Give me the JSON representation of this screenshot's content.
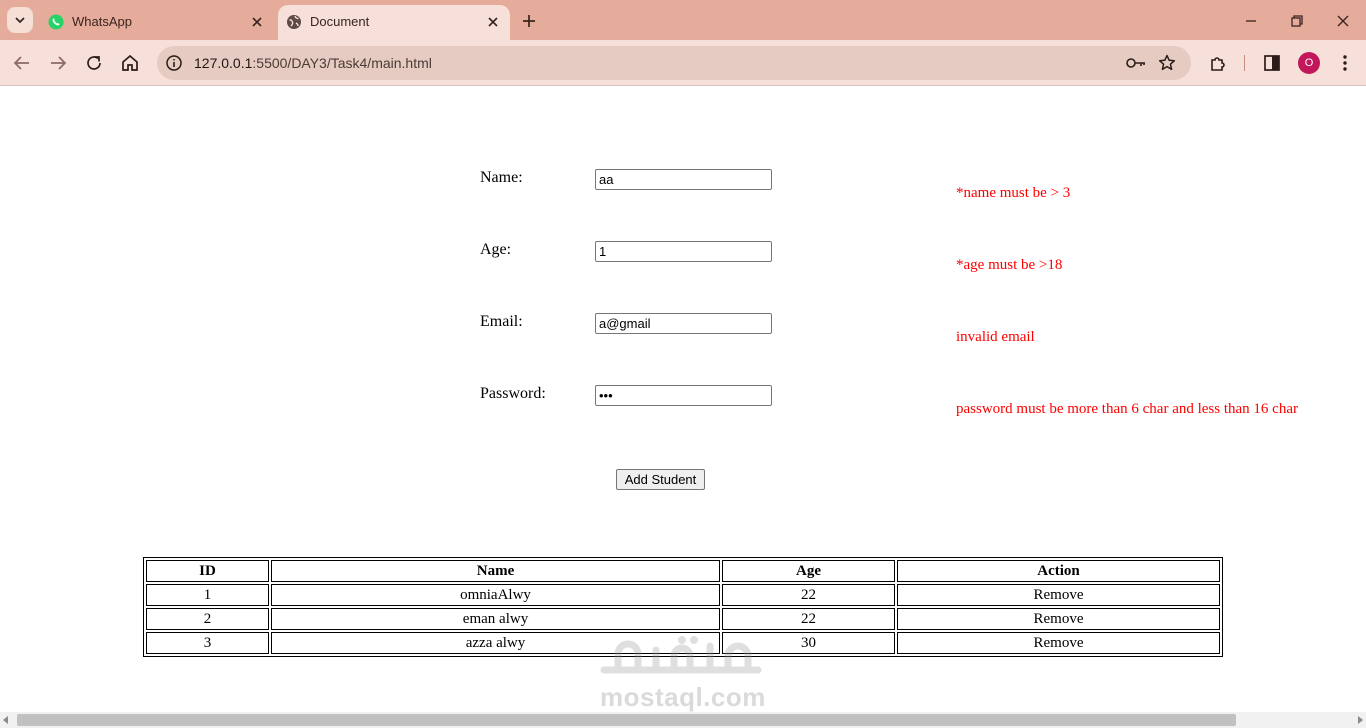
{
  "browser": {
    "tabs": [
      {
        "title": "WhatsApp",
        "icon": "whatsapp-icon",
        "active": false
      },
      {
        "title": "Document",
        "icon": "globe-icon",
        "active": true
      }
    ],
    "url": {
      "host": "127.0.0.1",
      "rest": ":5500/DAY3/Task4/main.html"
    },
    "profile_initial": "O",
    "colors": {
      "tabstrip": "#e5ab9b",
      "toolbar": "#f7e0d9",
      "omnibox": "#e6cbc2",
      "avatar": "#c2185b"
    }
  },
  "form": {
    "fields": [
      {
        "label": "Name:",
        "value": "aa",
        "type": "text",
        "error": "*name must be > 3"
      },
      {
        "label": "Age:",
        "value": "1",
        "type": "text",
        "error": "*age must be >18"
      },
      {
        "label": "Email:",
        "value": "a@gmail",
        "type": "text",
        "error": "invalid email"
      },
      {
        "label": "Password:",
        "value": "•••",
        "type": "password",
        "error": "password must be more than 6 char and less than 16 char"
      }
    ],
    "submit_label": "Add Student",
    "error_color": "#ff0000"
  },
  "table": {
    "headers": [
      "ID",
      "Name",
      "Age",
      "Action"
    ],
    "rows": [
      {
        "id": "1",
        "name": "omniaAlwy",
        "age": "22",
        "action": "Remove"
      },
      {
        "id": "2",
        "name": "eman alwy",
        "age": "22",
        "action": "Remove"
      },
      {
        "id": "3",
        "name": "azza alwy",
        "age": "30",
        "action": "Remove"
      }
    ]
  },
  "watermark": {
    "text": "mostaql.com"
  }
}
